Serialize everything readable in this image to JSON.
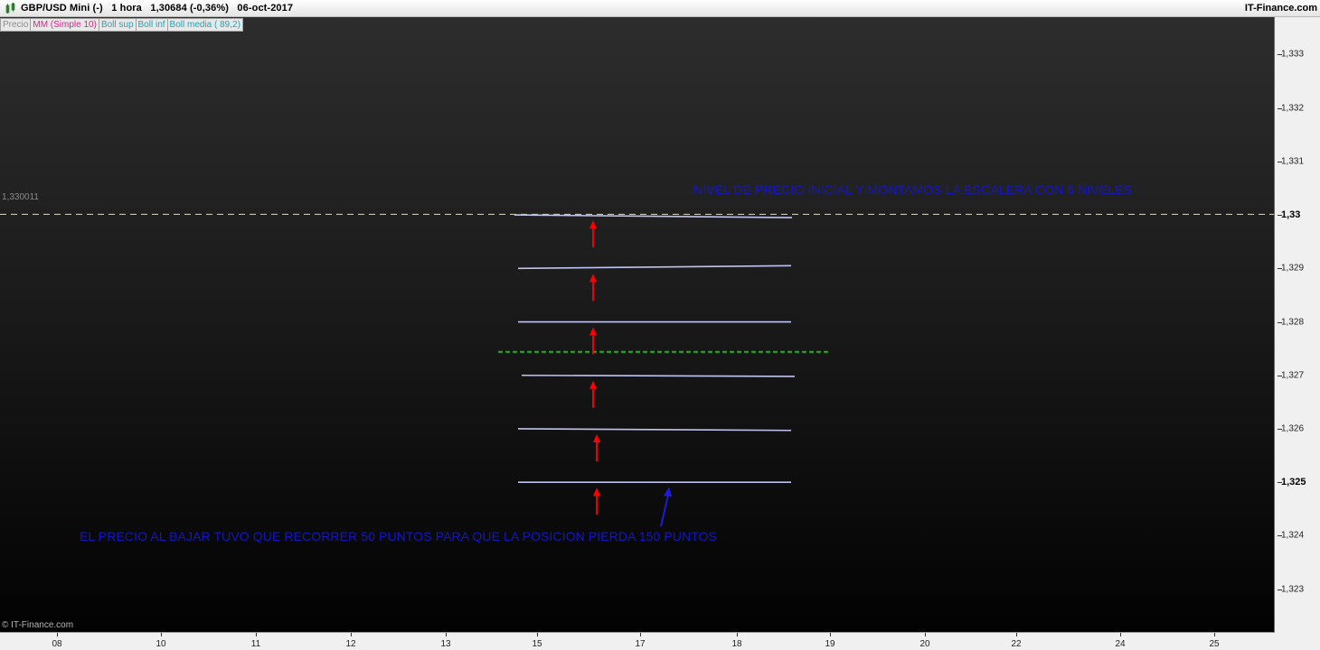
{
  "header": {
    "title": "GBP/USD Mini (-)   1 hora   1,30684 (-0,36%)   06-oct-2017",
    "brand": "IT-Finance.com"
  },
  "legend": [
    "Precio",
    "MM (Simple 10)",
    "Boll sup",
    "Boll inf",
    "Boll media ( 89,2)"
  ],
  "colors": {
    "title_icon": "#2aa52a",
    "ref_line": "#e6c84a",
    "ladder_lines": "#c0c4f0",
    "green_level": "#00c800",
    "arrows_red": "#ff0000",
    "arrow_blue": "#1a1ae0",
    "annotation_text": "#1515c8"
  },
  "copyright": "© IT-Finance.com",
  "chart_data": {
    "type": "line",
    "ylim": [
      1.3222,
      1.3337
    ],
    "y_ticks": [
      {
        "value": 1.333,
        "label": "1,333",
        "bold": false
      },
      {
        "value": 1.332,
        "label": "1,332",
        "bold": false
      },
      {
        "value": 1.331,
        "label": "1,331",
        "bold": false
      },
      {
        "value": 1.33,
        "label": "1,33",
        "bold": true
      },
      {
        "value": 1.329,
        "label": "1,329",
        "bold": false
      },
      {
        "value": 1.328,
        "label": "1,328",
        "bold": false
      },
      {
        "value": 1.327,
        "label": "1,327",
        "bold": false
      },
      {
        "value": 1.326,
        "label": "1,326",
        "bold": false
      },
      {
        "value": 1.325,
        "label": "1,325",
        "bold": true
      },
      {
        "value": 1.324,
        "label": "1,324",
        "bold": false
      },
      {
        "value": 1.323,
        "label": "1,323",
        "bold": false
      }
    ],
    "x_ticks": [
      "08",
      "10",
      "11",
      "12",
      "13",
      "15",
      "17",
      "18",
      "19",
      "20",
      "22",
      "24",
      "25"
    ],
    "reference_line": {
      "value": 1.330011,
      "label": "1,330011",
      "style": "dashed"
    },
    "ladder_levels": [
      {
        "from": 1.33,
        "to": 1.32995
      },
      {
        "from": 1.329,
        "to": 1.32905
      },
      {
        "from": 1.328,
        "to": 1.328
      },
      {
        "from": 1.327,
        "to": 1.32698
      },
      {
        "from": 1.326,
        "to": 1.32597
      },
      {
        "from": 1.325,
        "to": 1.325
      }
    ],
    "green_level": 1.32744,
    "annotations": {
      "top": "NIVEL DE PRECIO INICIAL Y MONTAMOS LA ESCALERA CON 6 NIVELES",
      "bottom": "EL PRECIO AL BAJAR TUVO QUE RECORRER 50 PUNTOS PARA QUE LA POSICION PIERDA 150 PUNTOS"
    }
  }
}
